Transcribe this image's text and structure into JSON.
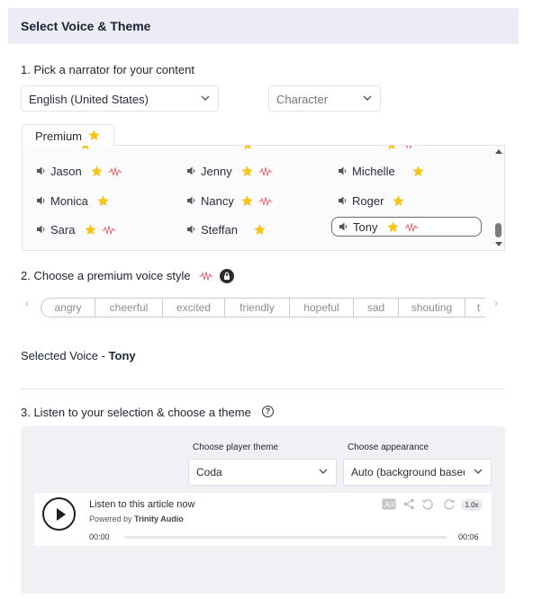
{
  "header": {
    "title": "Select Voice & Theme"
  },
  "step1": {
    "label": "1. Pick a narrator for your content",
    "language": "English (United States)",
    "character": "Character",
    "premium_tab": "Premium"
  },
  "voices": [
    {
      "name": "Jason",
      "star": true,
      "wave": true,
      "selected": false
    },
    {
      "name": "Jenny",
      "star": true,
      "wave": true,
      "selected": false
    },
    {
      "name": "Michelle",
      "star": true,
      "wave": false,
      "selected": false
    },
    {
      "name": "Monica",
      "star": true,
      "wave": false,
      "selected": false
    },
    {
      "name": "Nancy",
      "star": true,
      "wave": true,
      "selected": false
    },
    {
      "name": "Roger",
      "star": true,
      "wave": false,
      "selected": false
    },
    {
      "name": "Sara",
      "star": true,
      "wave": true,
      "selected": false
    },
    {
      "name": "Steffan",
      "star": true,
      "wave": false,
      "selected": false
    },
    {
      "name": "Tony",
      "star": true,
      "wave": true,
      "selected": true
    }
  ],
  "step2": {
    "label": "2. Choose a premium voice style",
    "styles": [
      "angry",
      "cheerful",
      "excited",
      "friendly",
      "hopeful",
      "sad",
      "shouting",
      "t"
    ],
    "prev_arrow": "‹",
    "next_arrow": "›"
  },
  "selected_voice": {
    "prefix": "Selected Voice - ",
    "name": "Tony"
  },
  "step3": {
    "label": "3. Listen to your selection & choose a theme",
    "help": "?",
    "player_theme_label": "Choose player theme",
    "player_theme_value": "Coda",
    "appearance_label": "Choose appearance",
    "appearance_value": "Auto (background based)"
  },
  "player": {
    "title": "Listen to this article now",
    "powered_prefix": "Powered by ",
    "powered_brand": "Trinity Audio",
    "time_current": "00:00",
    "time_total": "00:06",
    "speed": "1.0x",
    "progress": 0
  },
  "colors": {
    "star": "#f5c518",
    "wave": "#d9646e",
    "header_bg": "#ececf6"
  },
  "icons": {
    "speaker": "speaker-icon",
    "star": "star-icon",
    "wave": "voice-wave-icon",
    "lock": "lock-icon",
    "play": "play-icon"
  }
}
